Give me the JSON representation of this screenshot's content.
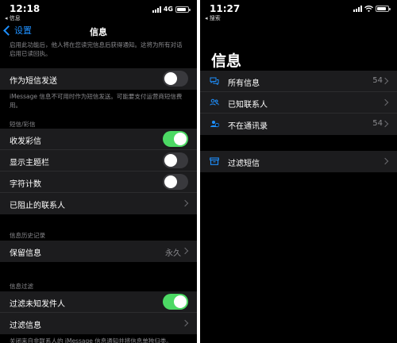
{
  "left": {
    "status": {
      "time": "12:18",
      "back_app": "◂ 信息",
      "network": "4G"
    },
    "nav": {
      "back_label": "设置",
      "title": "信息"
    },
    "top_note": "启用此功能后，他人将在您读完信息后获得通知。这将为所有对话启用已读回执。",
    "sms_row": {
      "label": "作为短信发送",
      "on": false
    },
    "sms_note": "iMessage 信息不可用时作为短信发送。可能要支付运营商短信费用。",
    "section_mms": "短信/彩信",
    "mms_rows": [
      {
        "label": "收发彩信",
        "type": "toggle",
        "on": true
      },
      {
        "label": "显示主题栏",
        "type": "toggle",
        "on": false
      },
      {
        "label": "字符计数",
        "type": "toggle",
        "on": false
      },
      {
        "label": "已阻止的联系人",
        "type": "link"
      }
    ],
    "section_history": "信息历史记录",
    "keep_row": {
      "label": "保留信息",
      "value": "永久"
    },
    "section_filter": "信息过滤",
    "filter_rows": [
      {
        "label": "过滤未知发件人",
        "type": "toggle",
        "on": true
      },
      {
        "label": "过滤信息",
        "type": "link"
      }
    ],
    "bottom_note": "关闭来自非联系人的 iMessage 信息通知并将信息单独归类。"
  },
  "right": {
    "status": {
      "time": "11:27",
      "back_app": "◂ 搜索"
    },
    "title": "信息",
    "rows": [
      {
        "label": "所有信息",
        "count": "54",
        "icon": "chat-bubbles-icon"
      },
      {
        "label": "已知联系人",
        "count": "",
        "icon": "contacts-icon"
      },
      {
        "label": "不在通讯录",
        "count": "54",
        "icon": "unknown-person-icon"
      }
    ],
    "junk_row": {
      "label": "过滤短信",
      "icon": "tray-icon"
    }
  },
  "colors": {
    "accent": "#1e90ff",
    "toggle_on": "#4cd964",
    "cell_bg": "#1c1c1e"
  }
}
